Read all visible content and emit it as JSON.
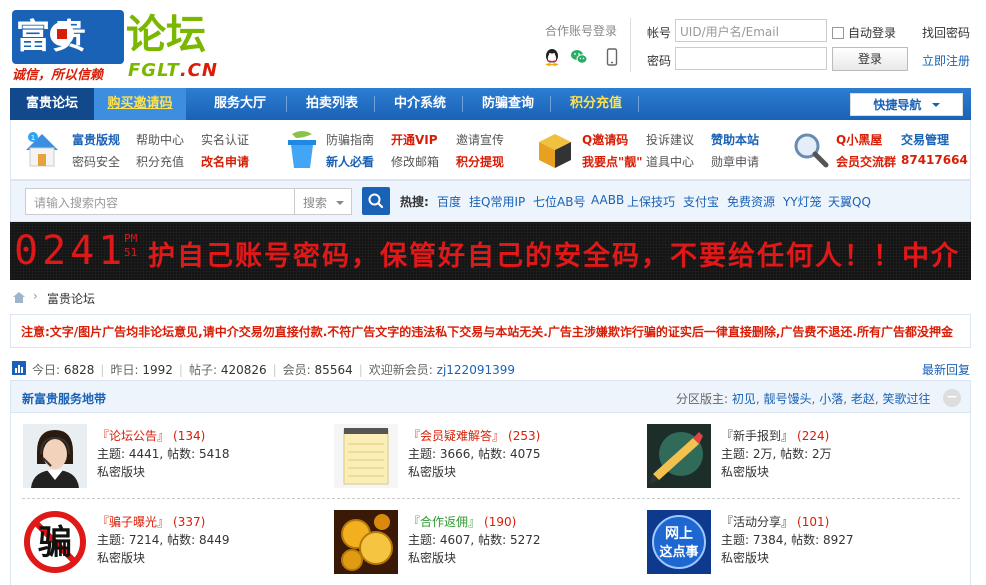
{
  "logo": {
    "brand_fugui": "富贵",
    "brand_luntan": "论坛",
    "slogan": "诚信，所以信赖",
    "site_en": "FGLT",
    "site_tld": ".CN"
  },
  "header": {
    "partner_login": "合作账号登录",
    "account_label": "帐号",
    "account_placeholder": "UID/用户名/Email",
    "password_label": "密码",
    "auto_login": "自动登录",
    "login_button": "登录",
    "forgot_password": "找回密码",
    "register": "立即注册"
  },
  "nav": {
    "items": [
      "富贵论坛",
      "购买邀请码",
      "服务大厅",
      "拍卖列表",
      "中介系统",
      "防骗查询",
      "积分充值"
    ],
    "quick_nav": "快捷导航"
  },
  "subnav": {
    "g1": [
      "富贵版规",
      "帮助中心",
      "实名认证",
      "密码安全",
      "积分充值",
      "改名申请"
    ],
    "g2": [
      "防骗指南",
      "开通VIP",
      "邀请宣传",
      "新人必看",
      "修改邮箱",
      "积分提现"
    ],
    "g3": [
      "Q邀请码",
      "投诉建议",
      "赞助本站",
      "我要点\"靓\"",
      "道具中心",
      "勋章申请"
    ],
    "g4": [
      "Q小黑屋",
      "交易管理",
      "会员交流群",
      "87417664"
    ]
  },
  "search": {
    "placeholder": "请输入搜索内容",
    "type": "搜索",
    "hot_label": "热搜:",
    "hot": [
      "百度",
      "挂Q常用IP",
      "七位AB号",
      "AABB",
      "上保技巧",
      "支付宝",
      "免费资源",
      "YY灯笼",
      "天翼QQ"
    ]
  },
  "led": {
    "time": "0241",
    "ampm_1": "PM",
    "ampm_2": "51",
    "text": "护自己账号密码，保管好自己的安全码，不要给任何人！！中介"
  },
  "breadcrumb": {
    "arrow": "›",
    "forum": "富贵论坛"
  },
  "notice": "注意:文字/图片广告均非论坛意见,请中介交易勿直接付款.不符广告文字的违法私下交易与本站无关.广告主涉嫌欺诈行骗的证实后一律直接删除,广告费不退还.所有广告都没押金",
  "stats": {
    "today_label": "今日:",
    "today": "6828",
    "yesterday_label": "昨日:",
    "yesterday": "1992",
    "posts_label": "帖子:",
    "posts": "420826",
    "members_label": "会员:",
    "members": "85564",
    "welcome_label": "欢迎新会员:",
    "new_member": "zj122091399",
    "latest_reply": "最新回复"
  },
  "group": {
    "title": "新富贵服务地带",
    "mods_label": "分区版主:",
    "mods": [
      "初见",
      "靓号馒头",
      "小落",
      "老赵",
      "笑歌过往"
    ],
    "collapse": "−"
  },
  "forums": [
    {
      "name": "『论坛公告』",
      "count": "(134)",
      "topics": "4441",
      "posts": "5418"
    },
    {
      "name": "『会员疑难解答』",
      "count": "(253)",
      "topics": "3666",
      "posts": "4075"
    },
    {
      "name": "『新手报到』",
      "count": "(224)",
      "topics": "2万",
      "posts": "2万"
    },
    {
      "name": "『骗子曝光』",
      "count": "(337)",
      "topics": "7214",
      "posts": "8449"
    },
    {
      "name": "『合作返佣』",
      "count": "(190)",
      "topics": "4607",
      "posts": "5272"
    },
    {
      "name": "『活动分享』",
      "count": "(101)",
      "topics": "7384",
      "posts": "8927"
    }
  ],
  "forum_labels": {
    "topics": "主题:",
    "posts": "帖数:",
    "private": "私密版块",
    "pian": "骗",
    "wangshang": "网上",
    "zhedianshi": "这点事"
  },
  "colors": {
    "brand_blue": "#1a62b6",
    "nav_dark": "#12498c",
    "alert_red": "#d81e06",
    "logo_green": "#7ab800",
    "led_bg": "#111111"
  }
}
